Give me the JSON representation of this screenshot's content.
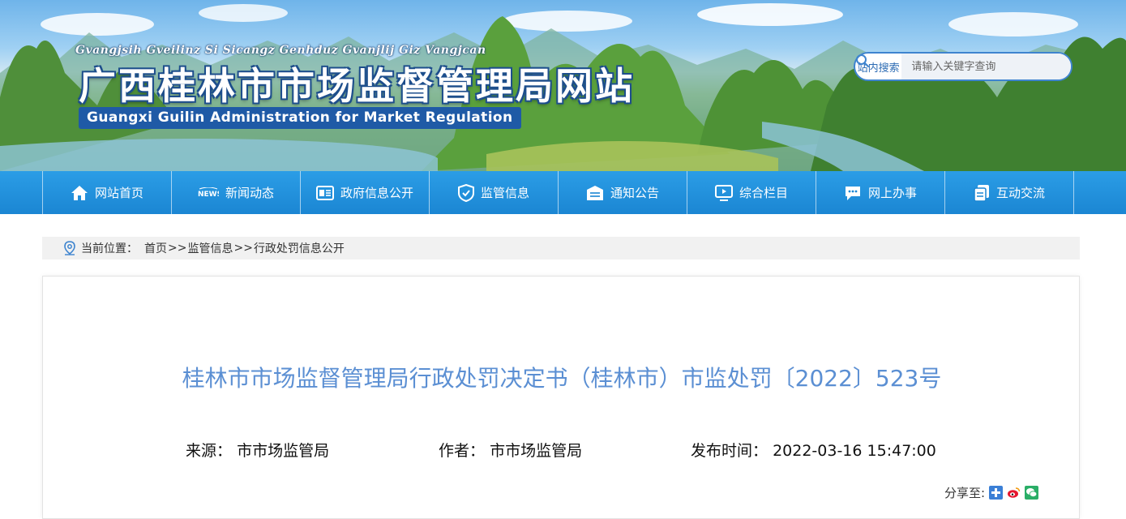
{
  "header": {
    "pinyin": "Gvangjsih Gveilinz Si Sicangz Genhduz Gvanjlij Giz Vangjcan",
    "title": "广西桂林市市场监督管理局网站",
    "english": "Guangxi Guilin Administration for Market Regulation",
    "search": {
      "label": "站内搜索",
      "placeholder": "请输入关键字查询",
      "icon": "search-icon"
    }
  },
  "nav": {
    "items": [
      {
        "label": "网站首页",
        "icon": "home-icon"
      },
      {
        "label": "新闻动态",
        "icon": "news-icon"
      },
      {
        "label": "政府信息公开",
        "icon": "document-icon"
      },
      {
        "label": "监管信息",
        "icon": "shield-icon"
      },
      {
        "label": "通知公告",
        "icon": "notice-icon"
      },
      {
        "label": "综合栏目",
        "icon": "monitor-icon"
      },
      {
        "label": "网上办事",
        "icon": "chat-icon"
      },
      {
        "label": "互动交流",
        "icon": "copy-icon"
      }
    ]
  },
  "breadcrumb": {
    "prefix": "当前位置：",
    "items": [
      "首页",
      "监管信息",
      "行政处罚信息公开"
    ],
    "separator": ">>"
  },
  "article": {
    "title": "桂林市市场监督管理局行政处罚决定书（桂林市）市监处罚〔2022〕523号",
    "source_label": "来源：",
    "source_value": "市市场监管局",
    "author_label": "作者：",
    "author_value": "市市场监管局",
    "time_label": "发布时间：",
    "time_value": "2022-03-16 15:47:00",
    "share_label": "分享至:"
  },
  "colors": {
    "nav_bg": "#1b86d3",
    "title_blue": "#5b8fd3",
    "share_qzone": "#3b7fd6",
    "share_weibo": "#e6162d",
    "share_wechat": "#2aae67"
  }
}
